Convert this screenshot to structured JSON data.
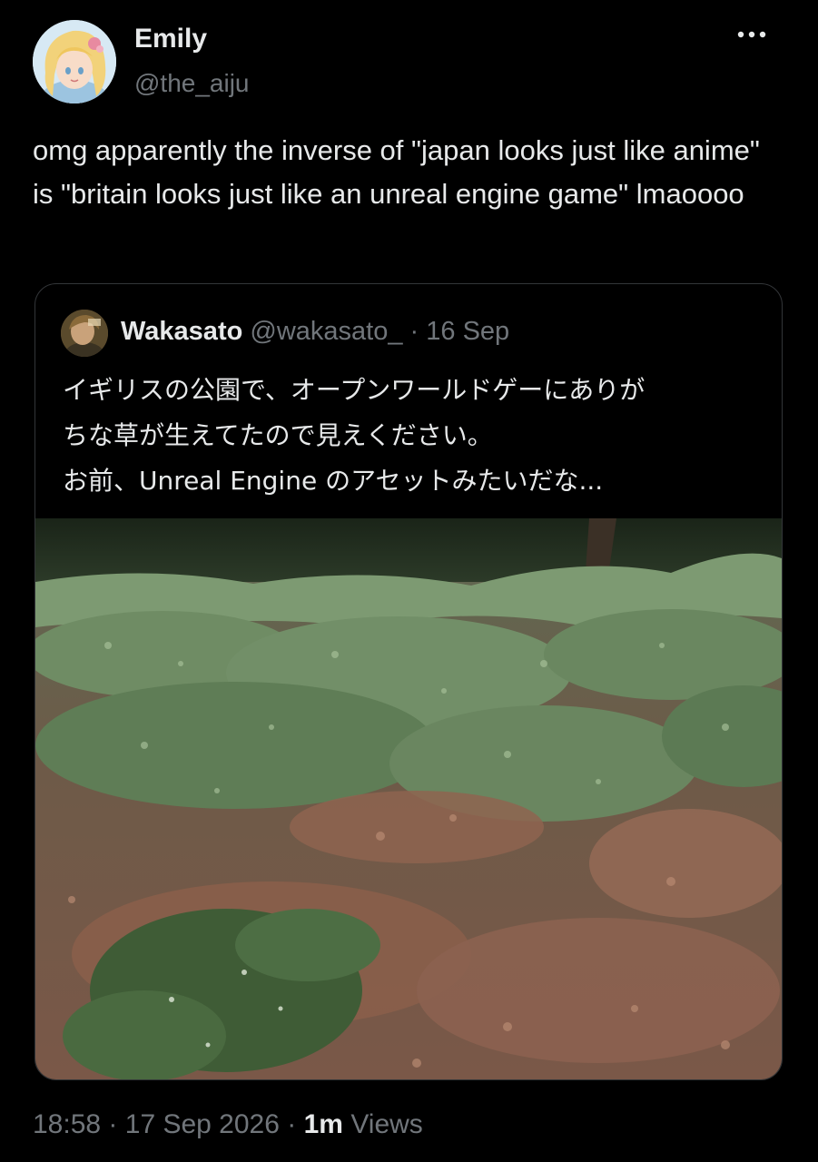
{
  "author": {
    "display_name": "Emily",
    "handle": "@the_aiju",
    "avatar_icon": "anime-girl-avatar-icon"
  },
  "more_icon": "more-horizontal-icon",
  "tweet": {
    "text": "omg apparently the inverse of \"japan looks just like anime\" is \"britain looks just like an unreal engine game\" lmaoooo"
  },
  "quoted": {
    "display_name": "Wakasato",
    "handle": "@wakasato_",
    "separator": "·",
    "date": "16 Sep",
    "avatar_icon": "portrait-avatar-icon",
    "lines": [
      "イギリスの公園で、オープンワールドゲーにありが",
      "ちな草が生えてたので見えください。",
      "お前、Unreal Engine のアセットみたいだな..."
    ],
    "photo_icon": "park-ground-cover-photo"
  },
  "meta": {
    "time": "18:58",
    "sep1": "·",
    "date": "17 Sep 2026",
    "sep2": "·",
    "views_count": "1m",
    "views_label": "Views"
  },
  "colors": {
    "background": "#000000",
    "text_primary": "#e7e9ea",
    "text_secondary": "#71767b",
    "card_border": "#333639"
  }
}
